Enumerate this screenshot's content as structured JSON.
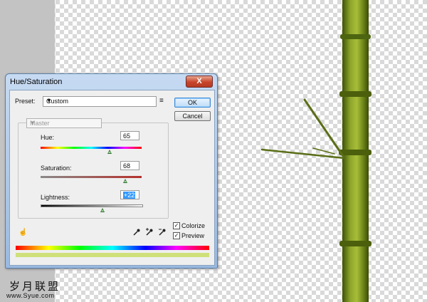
{
  "dialog": {
    "title": "Hue/Saturation",
    "close_label": "X",
    "preset_label": "Preset:",
    "preset_value": "Custom",
    "ok_label": "OK",
    "cancel_label": "Cancel",
    "channel_value": "Master",
    "hue": {
      "label": "Hue:",
      "value": "65",
      "min": -180,
      "max": 180
    },
    "saturation": {
      "label": "Saturation:",
      "value": "68",
      "min": -100,
      "max": 100
    },
    "lightness": {
      "label": "Lightness:",
      "value": "+22",
      "min": -100,
      "max": 100
    },
    "colorize_label": "Colorize",
    "colorize_checked": true,
    "preview_label": "Preview",
    "preview_checked": true
  },
  "watermark": {
    "text": "岁月联盟",
    "url": "www.Syue.com"
  },
  "colors": {
    "bamboo_dark": "#4b5f0c",
    "bamboo_light": "#8da52a",
    "accent": "#3399ff"
  }
}
